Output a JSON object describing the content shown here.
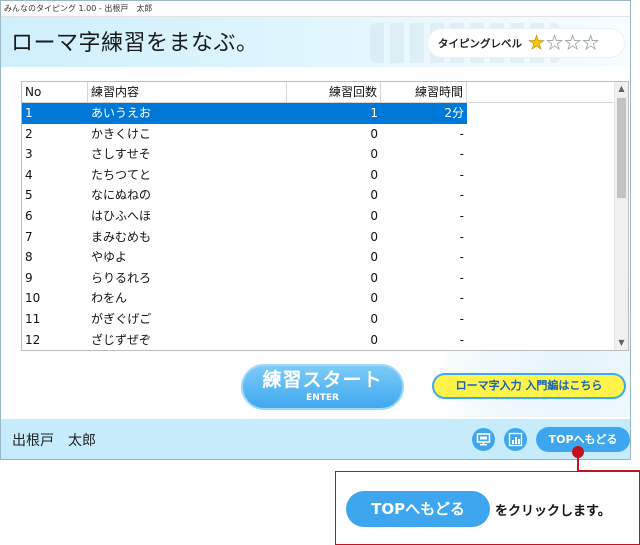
{
  "window": {
    "title": "みんなのタイピング 1.00 - 出根戸　太郎"
  },
  "header": {
    "title": "ローマ字練習をまなぶ。",
    "level_label": "タイピングレベル",
    "level_stars": {
      "filled": 1,
      "total": 4
    }
  },
  "table": {
    "columns": [
      "No",
      "練習内容",
      "練習回数",
      "練習時間"
    ],
    "rows": [
      {
        "no": "1",
        "name": "あいうえお",
        "count": "1",
        "time": "2分",
        "selected": true
      },
      {
        "no": "2",
        "name": "かきくけこ",
        "count": "0",
        "time": "-"
      },
      {
        "no": "3",
        "name": "さしすせそ",
        "count": "0",
        "time": "-"
      },
      {
        "no": "4",
        "name": "たちつてと",
        "count": "0",
        "time": "-"
      },
      {
        "no": "5",
        "name": "なにぬねの",
        "count": "0",
        "time": "-"
      },
      {
        "no": "6",
        "name": "はひふへほ",
        "count": "0",
        "time": "-"
      },
      {
        "no": "7",
        "name": "まみむめも",
        "count": "0",
        "time": "-"
      },
      {
        "no": "8",
        "name": "やゆよ",
        "count": "0",
        "time": "-"
      },
      {
        "no": "9",
        "name": "らりるれろ",
        "count": "0",
        "time": "-"
      },
      {
        "no": "10",
        "name": "わをん",
        "count": "0",
        "time": "-"
      },
      {
        "no": "11",
        "name": "がぎぐげご",
        "count": "0",
        "time": "-"
      },
      {
        "no": "12",
        "name": "ざじずぜぞ",
        "count": "0",
        "time": "-"
      }
    ]
  },
  "buttons": {
    "start_label": "練習スタート",
    "start_sub": "ENTER",
    "intro_label": "ローマ字入力 入門編はこちら",
    "top_label": "TOPへもどる"
  },
  "footer": {
    "user_name": "出根戸　太郎"
  },
  "icons": {
    "monitor": "monitor-icon",
    "chart": "bar-chart-icon",
    "star_filled": "star-filled-icon",
    "star_empty": "star-outline-icon"
  },
  "callout": {
    "button_label": "TOPへもどる",
    "text": "をクリックします。"
  },
  "colors": {
    "accent_blue": "#3ea6ee",
    "selection": "#0078d7",
    "header_bg": "#cfeffb",
    "footer_bg": "#c6ecfb",
    "intro_yellow": "#fff24a",
    "callout_red": "#c1121f"
  }
}
